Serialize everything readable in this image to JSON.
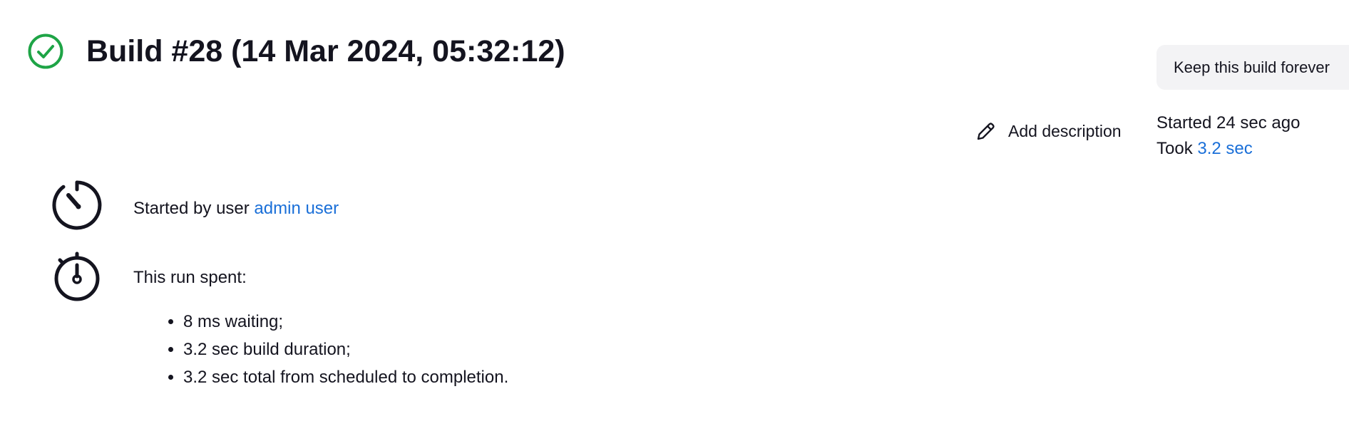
{
  "header": {
    "title": "Build #28 (14 Mar 2024, 05:32:12)",
    "status_icon": "success-check-circle-icon",
    "status_color": "#1ea446"
  },
  "actions": {
    "keep_forever_label": "Keep this build forever",
    "add_description_label": "Add description",
    "add_description_icon": "pencil-icon"
  },
  "meta": {
    "started": "Started 24 sec ago",
    "took_prefix": "Took ",
    "took_value": "3.2 sec"
  },
  "cause": {
    "icon": "cause-gauge-icon",
    "prefix": "Started by user ",
    "user": "admin user"
  },
  "timing": {
    "icon": "stopwatch-icon",
    "heading": "This run spent:",
    "items": [
      "8 ms waiting;",
      "3.2 sec build duration;",
      "3.2 sec total from scheduled to completion."
    ]
  },
  "colors": {
    "link": "#1a6fd8",
    "text": "#14141f",
    "button_bg": "#f3f3f5"
  }
}
